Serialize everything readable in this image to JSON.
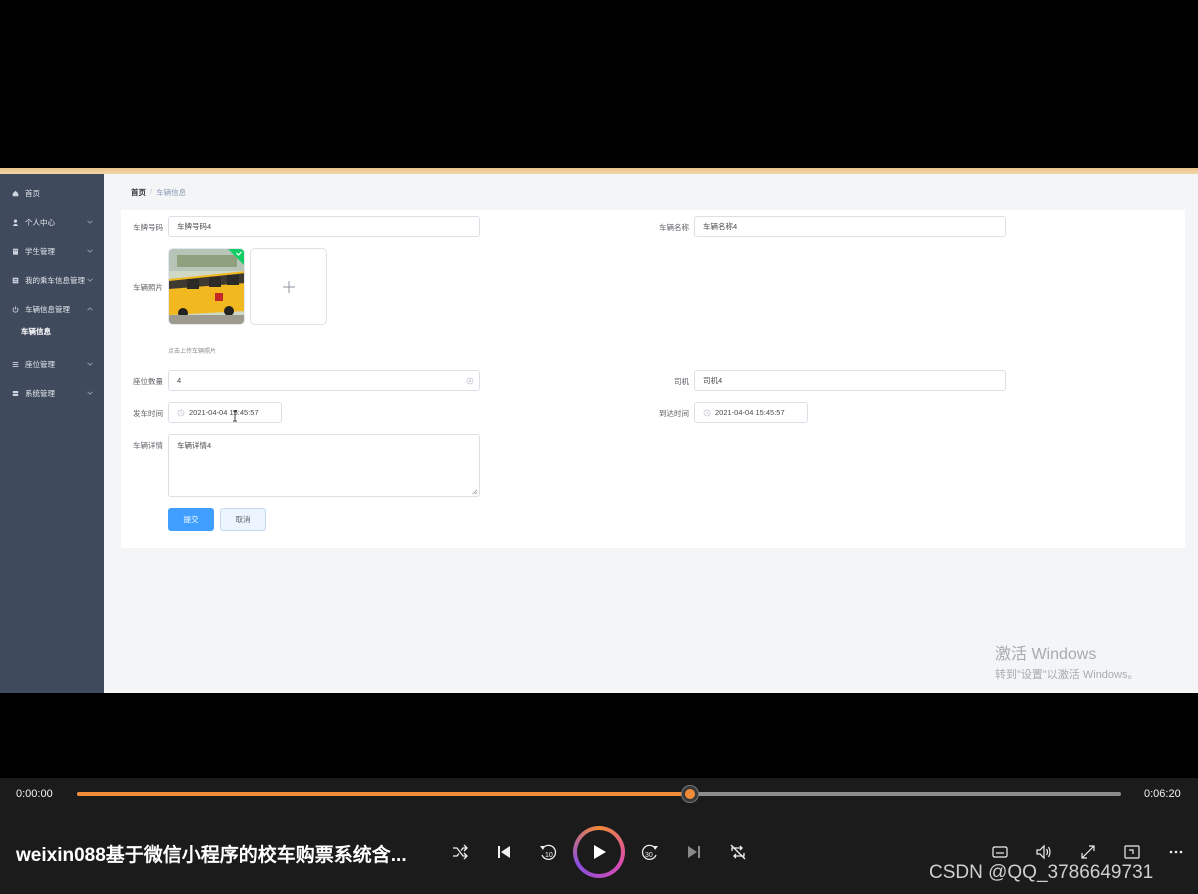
{
  "sidebar": {
    "items": [
      {
        "label": "首页",
        "icon": "home-icon"
      },
      {
        "label": "个人中心",
        "icon": "user-icon"
      },
      {
        "label": "学生管理",
        "icon": "building-icon"
      },
      {
        "label": "我的乘车信息管理",
        "icon": "list-icon"
      },
      {
        "label": "车辆信息管理",
        "icon": "power-icon"
      },
      {
        "label": "座位管理",
        "icon": "menu-icon"
      },
      {
        "label": "系统管理",
        "icon": "db-icon"
      }
    ],
    "sub_active": "车辆信息"
  },
  "breadcrumb": {
    "home": "首页",
    "sep": "/",
    "current": "车辆信息"
  },
  "form": {
    "plate_label": "车牌号码",
    "plate_value": "车牌号码4",
    "name_label": "车辆名称",
    "name_value": "车辆名称4",
    "photo_label": "车辆照片",
    "upload_tip": "点击上传车辆照片",
    "seats_label": "座位数量",
    "seats_value": "4",
    "driver_label": "司机",
    "driver_value": "司机4",
    "depart_label": "发车时间",
    "depart_value": "2021-04-04 15:45:57",
    "arrive_label": "到达时间",
    "arrive_value": "2021-04-04 15:45:57",
    "detail_label": "车辆详情",
    "detail_value": "车辆详情4",
    "submit_label": "提交",
    "cancel_label": "取消"
  },
  "watermark": {
    "line1": "激活 Windows",
    "line2": "转到\"设置\"以激活 Windows。"
  },
  "player": {
    "current_time": "0:00:00",
    "duration": "0:06:20",
    "progress": 0.587,
    "title": "weixin088基于微信小程序的校车购票系统含...",
    "watermark": "CSDN @QQ_3786649731",
    "accent": "#f28c38"
  }
}
